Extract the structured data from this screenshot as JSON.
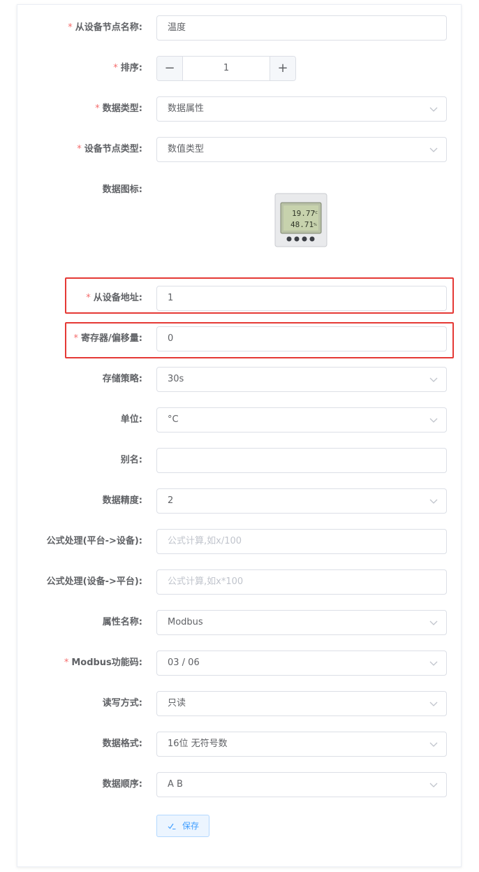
{
  "form": {
    "slave_name": {
      "label": "从设备节点名称:",
      "value": "温度"
    },
    "sort": {
      "label": "排序:",
      "value": "1",
      "minus": "−",
      "plus": "+"
    },
    "data_type": {
      "label": "数据类型:",
      "value": "数据属性"
    },
    "node_type": {
      "label": "设备节点类型:",
      "value": "数值类型"
    },
    "icon": {
      "label": "数据图标:",
      "reading_top": "19.77",
      "reading_bottom": "48.71",
      "unit_top": "°C",
      "unit_bottom": "%"
    },
    "slave_address": {
      "label": "从设备地址:",
      "value": "1"
    },
    "register_offset": {
      "label": "寄存器/偏移量:",
      "value": "0"
    },
    "storage_strategy": {
      "label": "存储策略:",
      "value": "30s"
    },
    "unit": {
      "label": "单位:",
      "value": "°C"
    },
    "alias": {
      "label": "别名:",
      "value": ""
    },
    "precision": {
      "label": "数据精度:",
      "value": "2"
    },
    "formula_to_device": {
      "label": "公式处理(平台->设备):",
      "placeholder": "公式计算,如x/100"
    },
    "formula_to_platform": {
      "label": "公式处理(设备->平台):",
      "placeholder": "公式计算,如x*100"
    },
    "attribute_name": {
      "label": "属性名称:",
      "value": "Modbus"
    },
    "modbus_function": {
      "label": "Modbus功能码:",
      "value": "03 / 06"
    },
    "rw_mode": {
      "label": "读写方式:",
      "value": "只读"
    },
    "data_format": {
      "label": "数据格式:",
      "value": "16位 无符号数"
    },
    "byte_order": {
      "label": "数据顺序:",
      "value": "A B"
    }
  },
  "actions": {
    "save_label": "保存"
  },
  "colors": {
    "required": "#f56c6c",
    "highlight": "#e53935",
    "primary": "#409eff"
  }
}
